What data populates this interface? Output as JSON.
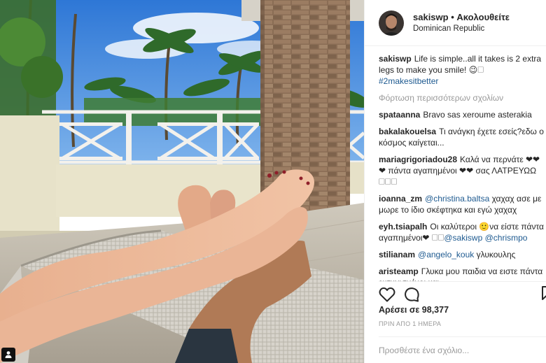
{
  "post": {
    "username": "sakiswp",
    "separator": "•",
    "follow_status": "Ακολουθείτε",
    "location": "Dominican Republic",
    "caption": {
      "username": "sakiswp",
      "text": "Life is simple..all it takes is 2 extra legs to make you smile! 😉🗆",
      "hashtag": "#2makesitbetter"
    },
    "load_more": "Φόρτωση περισσότερων σχολίων",
    "comments": [
      {
        "user": "spataanna",
        "parts": [
          {
            "t": "Bravo sas xeroume asterakia"
          }
        ]
      },
      {
        "user": "bakalakouelsa",
        "parts": [
          {
            "t": "Τι ανάγκη έχετε εσείς?εδω ο κόσμος καίγεται..."
          }
        ]
      },
      {
        "user": "mariagrigoriadou28",
        "parts": [
          {
            "t": "Καλά να περνάτε ❤❤❤ πάντα αγαπημένοι ❤❤ σας ΛΑΤΡΕΥΩΩ 🗆🗆🗆"
          }
        ]
      },
      {
        "user": "ioanna_zm",
        "parts": [
          {
            "m": "@christina.baltsa"
          },
          {
            "t": " χαχαχ ασε με μωρε το ίδιο σκέφτηκα και εγώ χαχαχ"
          }
        ]
      },
      {
        "user": "eyh.tsiapalh",
        "parts": [
          {
            "t": "Οι καλύτεροι 🙂να είστε πάντα αγαπημένοι❤ 🗆🗆"
          },
          {
            "m": "@sakiswp"
          },
          {
            "t": " "
          },
          {
            "m": "@chrismpo"
          }
        ]
      },
      {
        "user": "stilianam",
        "parts": [
          {
            "m": "@angelo_kouk"
          },
          {
            "t": " γλυκουλης"
          }
        ]
      },
      {
        "user": "aristeamp",
        "parts": [
          {
            "t": "Γλυκα μου παιδια να ειστε πάντα ευτυχισμένοι και"
          }
        ]
      }
    ],
    "likes": "Αρέσει σε 98,377",
    "time": "ΠΡΙΝ ΑΠΟ 1 ΗΜΕΡΑ",
    "add_comment_placeholder": "Προσθέστε ένα σχόλιο...",
    "icons": {
      "like": "heart-icon",
      "comment": "comment-icon",
      "save": "bookmark-icon",
      "user_tag": "user-tag-icon"
    },
    "colors": {
      "link": "#1e5a90",
      "muted": "#999999",
      "text": "#262626"
    }
  }
}
